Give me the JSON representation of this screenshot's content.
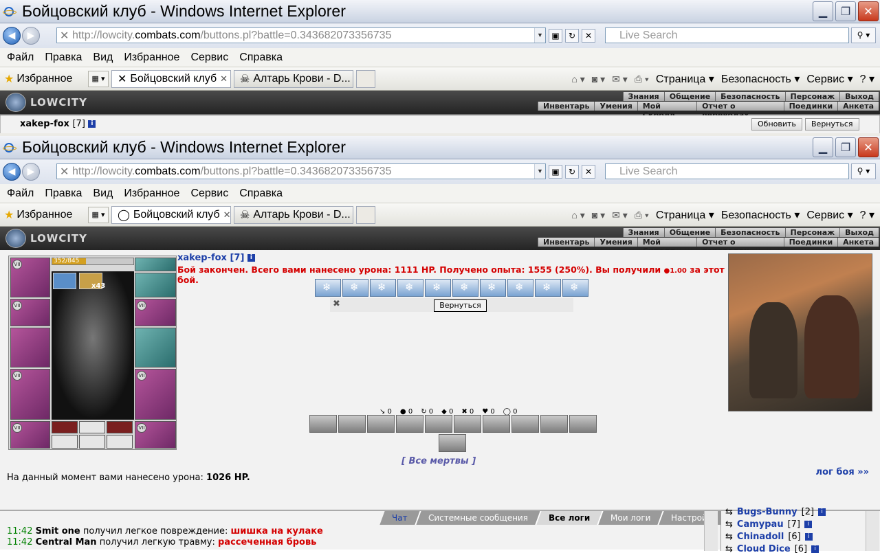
{
  "window": {
    "title": "Бойцовский клуб - Windows Internet Explorer",
    "min": "▁",
    "max": "❐",
    "close": "✕"
  },
  "address": {
    "prefix": "http://lowcity.",
    "domain": "combats.com",
    "suffix": "/buttons.pl?battle=0.343682073356735"
  },
  "search": {
    "placeholder": "Live Search"
  },
  "menu": [
    "Файл",
    "Правка",
    "Вид",
    "Избранное",
    "Сервис",
    "Справка"
  ],
  "favorites": "Избранное",
  "tabs": {
    "active": "Бойцовский клуб",
    "second": "Алтарь Крови - D..."
  },
  "commandbar": {
    "page": "Страница ▾",
    "safety": "Безопасность ▾",
    "service": "Сервис ▾",
    "help": "? ▾"
  },
  "game": {
    "logo": "LOWCITY",
    "links_top": [
      "Знания",
      "Общение",
      "Безопасность",
      "Персонаж",
      "Выход"
    ],
    "links_bottom": [
      "Инвентарь",
      "Умения",
      "Мой Скролл",
      "Отчет о переводах",
      "Поединки",
      "Анкета"
    ]
  },
  "top_window": {
    "nick": "xakep-fox",
    "level": "[7]",
    "refresh": "Обновить",
    "back": "Вернуться"
  },
  "character": {
    "hp": "352/845",
    "hp_fraction": 0.4166,
    "x43": "x43",
    "vii": "VII"
  },
  "battle": {
    "nick": "xakep-fox",
    "level": "[7]",
    "message": "Бой закончен. Всего вами нанесено урона: 1111 HP. Получено опыта: 1555 (250%). Вы получили",
    "reward": "1.00",
    "message_end": " за этот бой.",
    "back_button": "Вернуться",
    "stats": [
      "↘ 0",
      "● 0",
      "↻ 0",
      "◆ 0",
      "✖ 0",
      "♥ 0",
      "◯ 0"
    ],
    "all_dead": "[ Все мертвы ]",
    "damage_label": "На данный момент вами нанесено урона:",
    "damage_value": "1026 HP.",
    "log_link": "лог боя »»"
  },
  "chat": {
    "tabs": [
      "Чат",
      "Системные сообщения",
      "Все логи",
      "Мои логи",
      "Настройки"
    ],
    "lines": [
      {
        "time": "11:42",
        "who": "Smit one",
        "text": "получил легкое повреждение:",
        "detail": "шишка на кулаке"
      },
      {
        "time": "11:42",
        "who": "Central Man",
        "text": "получил легкую травму:",
        "detail": "рассеченная бровь"
      }
    ],
    "users": [
      {
        "name": "Bugs-Bunny",
        "level": "[2]"
      },
      {
        "name": "Camypau",
        "level": "[7]"
      },
      {
        "name": "Chinadoll",
        "level": "[6]"
      },
      {
        "name": "Cloud Dice",
        "level": "[6]"
      }
    ]
  }
}
